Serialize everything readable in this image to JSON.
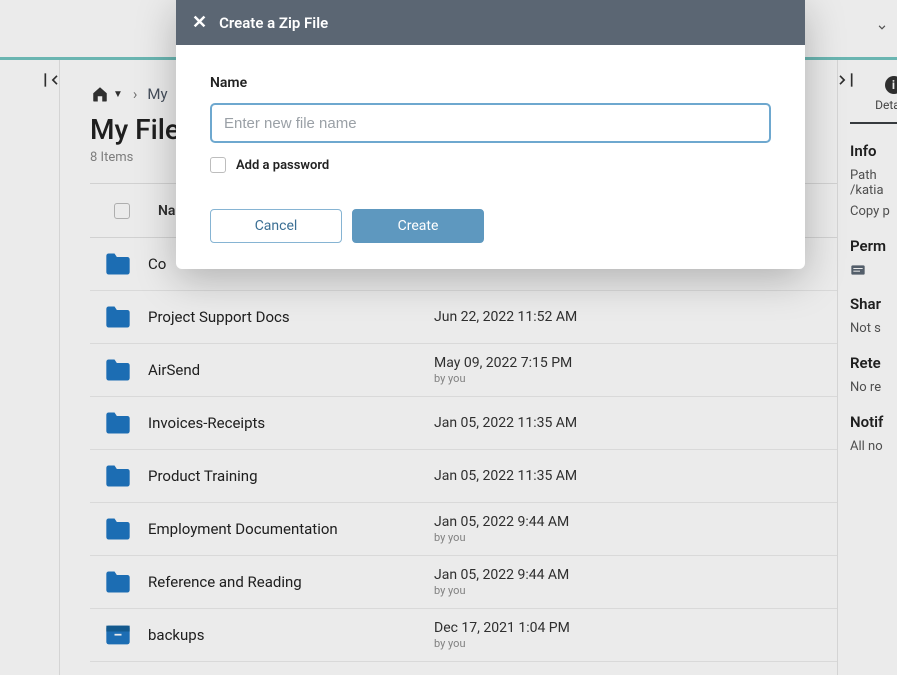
{
  "breadcrumb": {
    "current": "My"
  },
  "page": {
    "title": "My Files",
    "items_count": "8 Items"
  },
  "list": {
    "col_name": "Na"
  },
  "rows": [
    {
      "name": "Co",
      "date": "",
      "by": ""
    },
    {
      "name": "Project Support Docs",
      "date": "Jun 22, 2022 11:52 AM",
      "by": ""
    },
    {
      "name": "AirSend",
      "date": "May 09, 2022 7:15 PM",
      "by": "by you"
    },
    {
      "name": "Invoices-Receipts",
      "date": "Jan 05, 2022 11:35 AM",
      "by": ""
    },
    {
      "name": "Product Training",
      "date": "Jan 05, 2022 11:35 AM",
      "by": ""
    },
    {
      "name": "Employment Documentation",
      "date": "Jan 05, 2022 9:44 AM",
      "by": "by you"
    },
    {
      "name": "Reference and Reading",
      "date": "Jan 05, 2022 9:44 AM",
      "by": "by you"
    },
    {
      "name": "backups",
      "date": "Dec 17, 2021 1:04 PM",
      "by": "by you"
    }
  ],
  "sidebar": {
    "details_tab": "Details",
    "info_heading": "Info",
    "path_label": "Path",
    "path_value": "/katia",
    "copy_label": "Copy p",
    "perm_heading": "Perm",
    "share_heading": "Shar",
    "share_value": "Not s",
    "retention_heading": "Rete",
    "retention_value": "No re",
    "notif_heading": "Notif",
    "notif_value": "All no"
  },
  "modal": {
    "title": "Create a Zip File",
    "name_label": "Name",
    "name_placeholder": "Enter new file name",
    "add_password": "Add a password",
    "cancel": "Cancel",
    "create": "Create"
  }
}
